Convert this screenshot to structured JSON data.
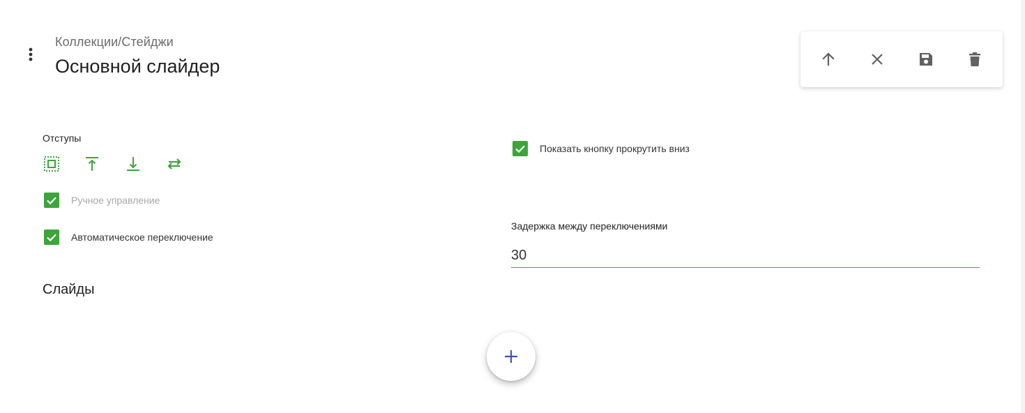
{
  "header": {
    "breadcrumb": "Коллекции/Стейджи",
    "title": "Основной слайдер",
    "menu_icon": "more-vert-icon"
  },
  "toolbar": {
    "buttons": [
      {
        "icon": "arrow-up-icon"
      },
      {
        "icon": "close-icon"
      },
      {
        "icon": "save-icon"
      },
      {
        "icon": "delete-icon"
      }
    ],
    "icon_color": "#616161"
  },
  "spacing": {
    "label": "Отступы",
    "icons": [
      "padding-all-icon",
      "padding-top-icon",
      "padding-bottom-icon",
      "padding-horizontal-icon"
    ],
    "accent": "#3da53a"
  },
  "options": {
    "manual_control": {
      "label": "Ручное управление",
      "checked": true,
      "disabled": true
    },
    "auto_switch": {
      "label": "Автоматическое переключение",
      "checked": true
    },
    "show_scroll_down": {
      "label": "Показать кнопку прокрутить вниз",
      "checked": true
    }
  },
  "delay": {
    "label": "Задержка между переключениями",
    "value": "30"
  },
  "slides": {
    "title": "Слайды",
    "add_icon": "plus-icon",
    "add_color": "#3f51b5"
  }
}
